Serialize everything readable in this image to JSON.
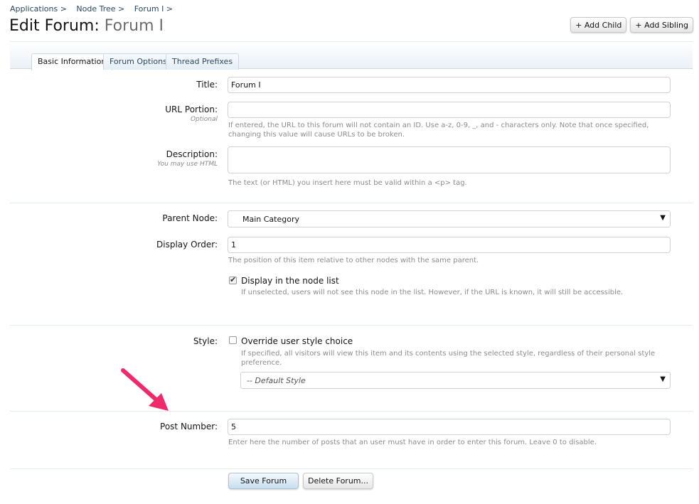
{
  "breadcrumb": [
    "Applications >",
    "Node Tree >",
    "Forum I >"
  ],
  "title": {
    "main": "Edit Forum:",
    "sub": "Forum I"
  },
  "top_buttons": {
    "add_child": "+ Add Child",
    "add_sibling": "+ Add Sibling"
  },
  "tabs": [
    "Basic Information",
    "Forum Options",
    "Thread Prefixes"
  ],
  "fields": {
    "title": {
      "label": "Title:",
      "value": "Forum I"
    },
    "url_portion": {
      "label": "URL Portion:",
      "hint": "Optional",
      "value": "",
      "explain1": "If entered, the URL to this forum will not contain an ID. Use a-z, 0-9, _, and - characters only. Note that once specified,",
      "explain2": "changing this value will cause URLs to be broken."
    },
    "description": {
      "label": "Description:",
      "hint": "You may use HTML",
      "value": "",
      "explain": "The text (or HTML) you insert here must be valid within a <p> tag."
    },
    "parent_node": {
      "label": "Parent Node:",
      "value": "Main Category"
    },
    "display_order": {
      "label": "Display Order:",
      "value": "1",
      "explain": "The position of this item relative to other nodes with the same parent."
    },
    "display_in_list": {
      "label": "Display in the node list",
      "checked": true,
      "explain": "If unselected, users will not see this node in the list. However, if the URL is known, it will still be accessible."
    },
    "style": {
      "label": "Style:",
      "checkbox_label": "Override user style choice",
      "checked": false,
      "explain1": "If specified, all visitors will view this item and its contents using the selected style, regardless of their personal style",
      "explain2": "preference.",
      "select_value": "-- Default Style"
    },
    "post_number": {
      "label": "Post Number:",
      "value": "5",
      "explain": "Enter here the number of posts that an user must have in order to enter this forum. Leave 0 to disable."
    }
  },
  "actions": {
    "save": "Save Forum",
    "delete": "Delete Forum..."
  },
  "colors": {
    "link": "#2b485c",
    "accent_arrow": "#ee2a6b",
    "muted": "#8c8c8c"
  },
  "icons": {
    "dropdown": "triangle-down-icon",
    "annotation": "pink-arrow-icon"
  }
}
